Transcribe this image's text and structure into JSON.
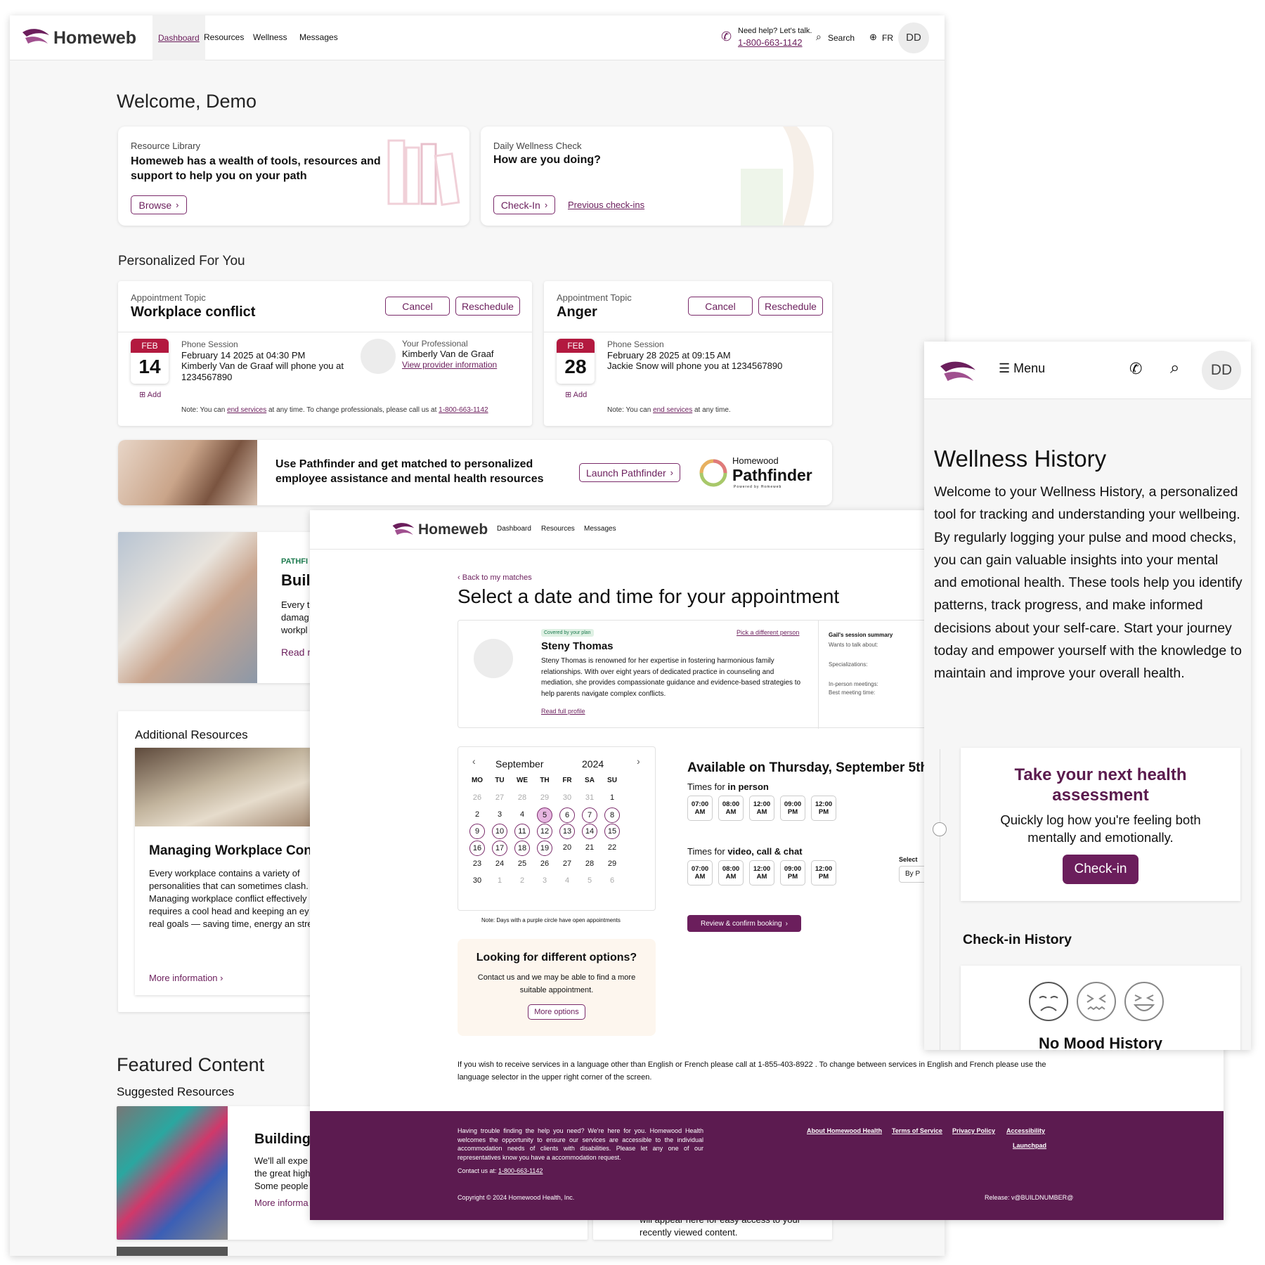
{
  "colors": {
    "brand": "#6b1e5c",
    "brand_dark": "#5b1b4e",
    "date_red": "#b3193f",
    "footer_bg": "#5c1b50"
  },
  "desktop": {
    "logo": "Homeweb",
    "nav": [
      "Dashboard",
      "Resources",
      "Wellness",
      "Messages"
    ],
    "help_label": "Need help? Let's talk.",
    "phone": "1-800-663-1142",
    "search": "Search",
    "lang": "FR",
    "avatar": "DD",
    "welcome": "Welcome, Demo",
    "library": {
      "eyebrow": "Resource Library",
      "title": "Homeweb has a wealth of tools, resources and support to help you on your path",
      "button": "Browse"
    },
    "wellness_check": {
      "eyebrow": "Daily Wellness Check",
      "title": "How are you doing?",
      "button": "Check-In",
      "link": "Previous check-ins"
    },
    "personalized_title": "Personalized For You",
    "appointments": [
      {
        "eyebrow": "Appointment Topic",
        "topic": "Workplace conflict",
        "cancel": "Cancel",
        "reschedule": "Reschedule",
        "month": "FEB",
        "day": "14",
        "add": "Add",
        "session": "Phone Session",
        "datetime": "February 14 2025 at 04:30 PM",
        "detail": "Kimberly Van de Graaf will phone you at 1234567890",
        "pro_label": "Your Professional",
        "pro_name": "Kimberly Van de Graaf",
        "pro_link": "View provider information",
        "note_a": "Note: You can",
        "note_link": "end services",
        "note_b": "at any time. To change professionals, please call us at",
        "note_phone": "1-800-663-1142"
      },
      {
        "eyebrow": "Appointment Topic",
        "topic": "Anger",
        "cancel": "Cancel",
        "reschedule": "Reschedule",
        "month": "FEB",
        "day": "28",
        "add": "Add",
        "session": "Phone Session",
        "datetime": "February 28 2025 at 09:15 AM",
        "detail": "Jackie Snow will phone you at 1234567890",
        "note_a": "Note: You can",
        "note_link": "end services",
        "note_b": "at any time."
      }
    ],
    "pathfinder": {
      "text": "Use Pathfinder and get matched to personalized employee assistance and mental health resources",
      "button": "Launch Pathfinder",
      "brand_top": "Homewood",
      "brand_name": "Pathfinder",
      "brand_sub": "Powered by Homeweb"
    },
    "article": {
      "eyebrow": "PATHFI",
      "title": "Buil",
      "body": [
        "Every t",
        "damag",
        "workpl"
      ],
      "link": "Read m"
    },
    "additional": {
      "title": "Additional Resources",
      "card_title": "Managing Workplace Con",
      "body": "Every workplace contains a variety of personalities that can sometimes clash. Managing workplace conflict effectively requires a cool head and keeping an ey the real goals — saving time, energy an stress.",
      "link": "More information"
    },
    "featured": {
      "title": "Featured Content",
      "sub": "Suggested Resources",
      "card_title": "Building",
      "body": [
        "We'll all expe",
        "the great high",
        "Some people"
      ],
      "link": "More informa"
    },
    "recent_text": "will appear here for easy access to your recently viewed content."
  },
  "booking": {
    "logo": "Homeweb",
    "nav": [
      "Dashboard",
      "Resources",
      "Messages"
    ],
    "back": "Back to my matches",
    "title": "Select a date and time for your appointment",
    "badge": "Covered by your plan",
    "pick": "Pick a different person",
    "name": "Steny Thomas",
    "bio": "Steny Thomas is renowned for her expertise in fostering harmonious family relationships. With over eight years of dedicated practice in counseling and mediation, she provides compassionate guidance and evidence-based strategies to help parents navigate complex conflicts.",
    "profile_link": "Read full profile",
    "summary": {
      "title": "Gail's session summary",
      "wants": "Wants to talk about:",
      "spec": "Specializations:",
      "inperson": "In-person meetings:",
      "best": "Best meeting time:"
    },
    "calendar": {
      "month": "September",
      "year": "2024",
      "dow": [
        "MO",
        "TU",
        "WE",
        "TH",
        "FR",
        "SA",
        "SU"
      ],
      "weeks": [
        [
          "26",
          "27",
          "28",
          "29",
          "30",
          "31",
          "1"
        ],
        [
          "2",
          "3",
          "4",
          "5",
          "6",
          "7",
          "8"
        ],
        [
          "9",
          "10",
          "11",
          "12",
          "13",
          "14",
          "15"
        ],
        [
          "16",
          "17",
          "18",
          "19",
          "20",
          "21",
          "22"
        ],
        [
          "23",
          "24",
          "25",
          "26",
          "27",
          "28",
          "29"
        ],
        [
          "30",
          "1",
          "2",
          "3",
          "4",
          "5",
          "6"
        ]
      ],
      "available": [
        "5",
        "6",
        "7",
        "8",
        "9",
        "10",
        "11",
        "12",
        "13",
        "14",
        "15",
        "16",
        "17",
        "18",
        "19"
      ],
      "selected": "5"
    },
    "cal_note": "Note: Days with a purple circle have open appointments",
    "available_heading": "Available on Thursday, September 5th",
    "times_inperson_label": "Times for",
    "times_inperson_bold": "in person",
    "times_video_label": "Times for",
    "times_video_bold": "video, call & chat",
    "slots": [
      [
        "07:00",
        "AM"
      ],
      [
        "08:00",
        "AM"
      ],
      [
        "12:00",
        "AM"
      ],
      [
        "09:00",
        "PM"
      ],
      [
        "12:00",
        "PM"
      ]
    ],
    "select_label": "Select",
    "select_value": "By P",
    "review_button": "Review & confirm booking",
    "options": {
      "title": "Looking for different options?",
      "text": "Contact us and we may be able to find a more suitable appointment.",
      "button": "More options"
    },
    "language_note": "If you wish to receive services in a language other than English or French please call at 1-855-403-8922 . To change between services in English and French please use the language selector in the upper right corner of the screen.",
    "footer": {
      "text": "Having trouble finding the help you need? We're here for you. Homewood Health welcomes the opportunity to ensure our services are accessible to the individual accommodation needs of clients with disabilities. Please let any one of our representatives know you have a accommodation request.",
      "contact": "Contact us at:",
      "phone": "1-800-663-1142",
      "links": [
        "About Homewood Health",
        "Terms of Service",
        "Privacy Policy",
        "Accessibility"
      ],
      "launchpad": "Launchpad",
      "copyright": "Copyright © 2024 Homewood Health, Inc.",
      "release": "Release: v@BUILDNUMBER@"
    }
  },
  "mobile": {
    "menu": "Menu",
    "avatar": "DD",
    "title": "Wellness History",
    "intro": "Welcome to your Wellness History, a personalized tool for tracking and understanding your wellbeing. By regularly logging your pulse and mood checks, you can gain valuable insights into your mental and emotional health. These tools help you identify patterns, track progress, and make informed decisions about your self-care. Start your journey today and empower yourself with the knowledge to maintain and improve your overall health.",
    "assessment_title": "Take your next health assessment",
    "assessment_text": "Quickly log how you're feeling both mentally and emotionally.",
    "checkin": "Check-in",
    "history_title": "Check-in History",
    "no_mood": "No Mood History"
  }
}
